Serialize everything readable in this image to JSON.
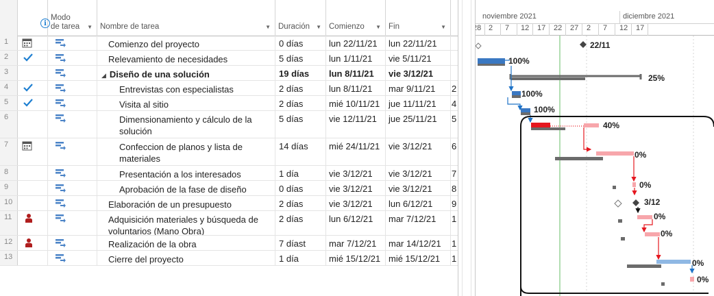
{
  "header": {
    "mode_label_line1": "Modo",
    "mode_label_line2": "de tarea",
    "name_label": "Nombre de tarea",
    "duration_label": "Duración",
    "start_label": "Comienzo",
    "end_label": "Fin"
  },
  "timescale": {
    "months": [
      "noviembre 2021",
      "diciembre 2021"
    ],
    "days": [
      "28",
      "2",
      "7",
      "12",
      "17",
      "22",
      "27",
      "2",
      "7",
      "12",
      "17"
    ]
  },
  "tasks": [
    {
      "id": "1",
      "indicator": "calendar-icon",
      "name": "Comienzo del proyecto",
      "duration": "0 días",
      "start": "lun 22/11/21",
      "end": "lun 22/11/21",
      "pred": "",
      "bold": false,
      "indent": 1
    },
    {
      "id": "2",
      "indicator": "check-icon",
      "name": "Relevamiento de necesidades",
      "duration": "5 días",
      "start": "lun 1/11/21",
      "end": "vie 5/11/21",
      "pred": "",
      "bold": false,
      "indent": 1
    },
    {
      "id": "3",
      "indicator": "",
      "name": "Diseño de una solución",
      "duration": "19 días",
      "start": "lun 8/11/21",
      "end": "vie 3/12/21",
      "pred": "",
      "bold": true,
      "indent": 0
    },
    {
      "id": "4",
      "indicator": "check-icon",
      "name": "Entrevistas con especialistas",
      "duration": "2 días",
      "start": "lun 8/11/21",
      "end": "mar 9/11/21",
      "pred": "2",
      "bold": false,
      "indent": 2
    },
    {
      "id": "5",
      "indicator": "check-icon",
      "name": "Visita al sitio",
      "duration": "2 días",
      "start": "mié 10/11/21",
      "end": "jue 11/11/21",
      "pred": "4",
      "bold": false,
      "indent": 2
    },
    {
      "id": "6",
      "indicator": "",
      "name": "Dimensionamiento y cálculo de la solución",
      "duration": "5 días",
      "start": "vie 12/11/21",
      "end": "jue 25/11/21",
      "pred": "5",
      "bold": false,
      "indent": 2
    },
    {
      "id": "7",
      "indicator": "calendar-icon",
      "name": "Confeccion de planos y lista de materiales",
      "duration": "14 días",
      "start": "mié 24/11/21",
      "end": "vie 3/12/21",
      "pred": "6",
      "bold": false,
      "indent": 2
    },
    {
      "id": "8",
      "indicator": "",
      "name": "Presentación a los interesados",
      "duration": "1 día",
      "start": "vie 3/12/21",
      "end": "vie 3/12/21",
      "pred": "7",
      "bold": false,
      "indent": 2
    },
    {
      "id": "9",
      "indicator": "",
      "name": "Aprobación de la fase de diseño",
      "duration": "0 días",
      "start": "vie 3/12/21",
      "end": "vie 3/12/21",
      "pred": "8",
      "bold": false,
      "indent": 2
    },
    {
      "id": "10",
      "indicator": "",
      "name": "Elaboración de un presupuesto",
      "duration": "2 días",
      "start": "vie 3/12/21",
      "end": "lun 6/12/21",
      "pred": "9",
      "bold": false,
      "indent": 1
    },
    {
      "id": "11",
      "indicator": "resource-icon",
      "name": "Adquisición materiales y búsqueda de voluntarios (Mano Obra)",
      "duration": "2 días",
      "start": "lun 6/12/21",
      "end": "mar 7/12/21",
      "pred": "1",
      "bold": false,
      "indent": 1
    },
    {
      "id": "12",
      "indicator": "resource-icon",
      "name": "Realización de la obra",
      "duration": "7 díast",
      "start": "mar 7/12/21",
      "end": "mar 14/12/21",
      "pred": "1",
      "bold": false,
      "indent": 1
    },
    {
      "id": "13",
      "indicator": "",
      "name": "Cierre del proyecto",
      "duration": "1 día",
      "start": "mié 15/12/21",
      "end": "mié 15/12/21",
      "pred": "1",
      "bold": false,
      "indent": 1
    }
  ],
  "gantt_labels": {
    "milestone_1": "22/11",
    "summary_pct": "25%",
    "t2_pct": "100%",
    "t4_pct": "100%",
    "t5_pct": "100%",
    "t6_pct": "40%",
    "t7_pct": "0%",
    "t8_pct": "0%",
    "milestone_9": "3/12",
    "t10_pct": "0%",
    "t11_pct": "0%",
    "t12_pct": "0%",
    "t13_pct": "0%"
  },
  "colors": {
    "check": "#1e7fd1",
    "done_bar": "#3a78c2",
    "baseline": "#6b6b6b",
    "critical": "#e5171f",
    "critical_remaining": "#f7a6ab",
    "pending_blue": "#8fb8e4",
    "today_line": "#7fc77f",
    "resource": "#b01e1e"
  }
}
